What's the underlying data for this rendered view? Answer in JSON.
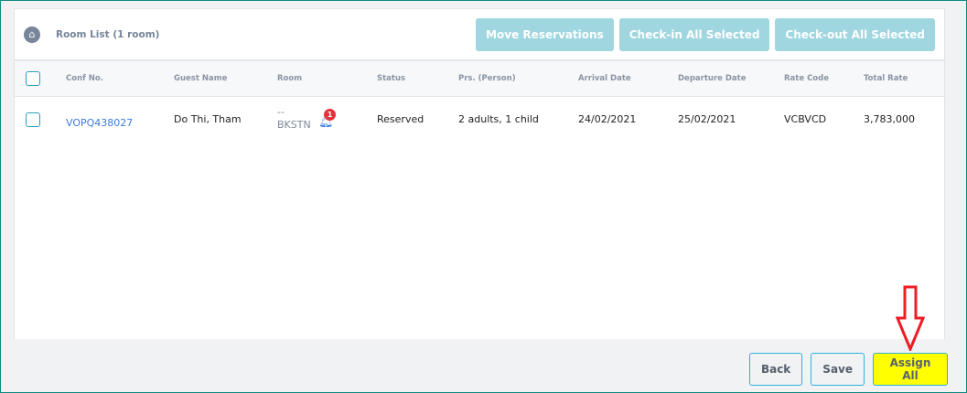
{
  "header": {
    "title": "Room List (1 room)",
    "buttons": [
      "Move Reservations",
      "Check-in All Selected",
      "Check-out All Selected"
    ]
  },
  "columns": [
    "Conf No.",
    "Guest Name",
    "Room",
    "Status",
    "Prs. (Person)",
    "Arrival Date",
    "Departure Date",
    "Rate Code",
    "Total Rate"
  ],
  "rows": [
    {
      "conf": "VOPQ438027",
      "guest": "Do Thi, Tham",
      "room_top": "--",
      "room": "BKSTN",
      "notif": "1",
      "status": "Reserved",
      "persons": "2 adults, 1 child",
      "arrival": "24/02/2021",
      "departure": "25/02/2021",
      "rate_code": "VCBVCD",
      "total": "3,783,000"
    }
  ],
  "footer": {
    "back": "Back",
    "save": "Save",
    "assign_all": "Assign All"
  },
  "colors": {
    "accent": "#9fd6df",
    "highlight": "#ffff00",
    "arrow": "#ee1c24"
  }
}
